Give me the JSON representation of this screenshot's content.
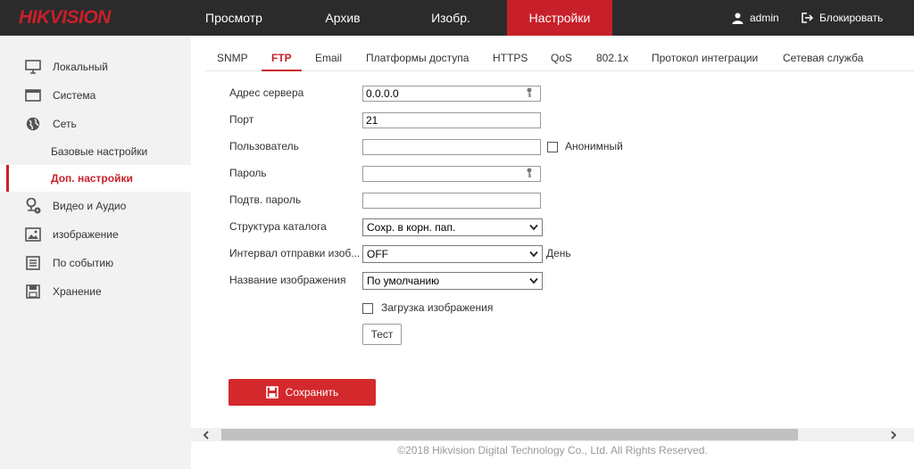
{
  "brand": {
    "logo_text": "HIKVISION",
    "accent_color": "#c8202a"
  },
  "nav": {
    "items": [
      {
        "label": "Просмотр"
      },
      {
        "label": "Архив"
      },
      {
        "label": "Изобр."
      },
      {
        "label": "Настройки",
        "active": true
      }
    ],
    "user_label": "admin",
    "logout_label": "Блокировать"
  },
  "sidebar": {
    "items": [
      {
        "label": "Локальный",
        "icon": "monitor-icon"
      },
      {
        "label": "Система",
        "icon": "window-icon"
      },
      {
        "label": "Сеть",
        "icon": "globe-icon"
      },
      {
        "label": "Базовые настройки",
        "sub": true
      },
      {
        "label": "Доп. настройки",
        "sub": true,
        "active": true
      },
      {
        "label": "Видео и Аудио",
        "icon": "mic-camera-icon"
      },
      {
        "label": "изображение",
        "icon": "image-icon"
      },
      {
        "label": "По событию",
        "icon": "event-list-icon"
      },
      {
        "label": "Хранение",
        "icon": "storage-icon"
      }
    ]
  },
  "tabs": [
    {
      "label": "SNMP"
    },
    {
      "label": "FTP",
      "active": true
    },
    {
      "label": "Email"
    },
    {
      "label": "Платформы доступа"
    },
    {
      "label": "HTTPS"
    },
    {
      "label": "QoS"
    },
    {
      "label": "802.1x"
    },
    {
      "label": "Протокол интеграции"
    },
    {
      "label": "Сетевая служба"
    }
  ],
  "form": {
    "server_address": {
      "label": "Адрес сервера",
      "value": "0.0.0.0"
    },
    "port": {
      "label": "Порт",
      "value": "21"
    },
    "user": {
      "label": "Пользователь",
      "value": ""
    },
    "anonymous": {
      "label": "Анонимный",
      "checked": false
    },
    "password": {
      "label": "Пароль",
      "value": ""
    },
    "confirm_password": {
      "label": "Подтв. пароль",
      "value": ""
    },
    "directory_structure": {
      "label": "Структура каталога",
      "value": "Сохр. в корн. пап."
    },
    "upload_interval": {
      "label": "Интервал отправки изоб...",
      "value": "OFF",
      "unit": "День"
    },
    "image_name": {
      "label": "Название изображения",
      "value": "По умолчанию"
    },
    "upload_image": {
      "label": "Загрузка изображения",
      "checked": false
    },
    "test_button": "Тест",
    "save_button": "Сохранить"
  },
  "footer": "©2018 Hikvision Digital Technology Co., Ltd. All Rights Reserved."
}
